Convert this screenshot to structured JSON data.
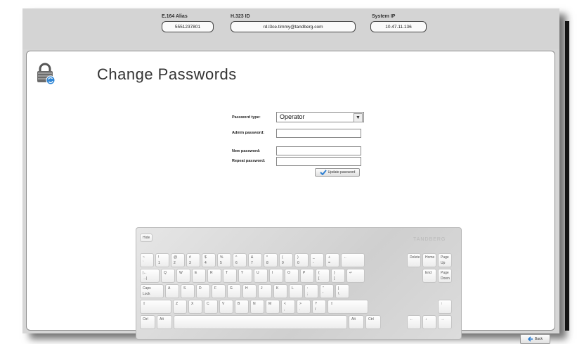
{
  "header": {
    "e164_label": "E.164 Alias",
    "e164_value": "5551237801",
    "h323_label": "H.323 ID",
    "h323_value": "rd.l3ce.timmy@tandberg.com",
    "ip_label": "System IP",
    "ip_value": "10.47.11.136"
  },
  "page": {
    "title": "Change Passwords",
    "icon": "lock-icon"
  },
  "form": {
    "password_type_label": "Password type:",
    "password_type_value": "Operator",
    "admin_password_label": "Admin password:",
    "new_password_label": "New password:",
    "repeat_password_label": "Repeat password:",
    "update_button_label": "Update password"
  },
  "keyboard": {
    "hide_label": "Hide",
    "brand": "TANDBERG",
    "row1": [
      {
        "t": "~",
        "b": "`"
      },
      {
        "t": "!",
        "b": "1"
      },
      {
        "t": "@",
        "b": "2"
      },
      {
        "t": "#",
        "b": "3"
      },
      {
        "t": "$",
        "b": "4"
      },
      {
        "t": "%",
        "b": "5"
      },
      {
        "t": "^",
        "b": "6"
      },
      {
        "t": "&",
        "b": "7"
      },
      {
        "t": "*",
        "b": "8"
      },
      {
        "t": "(",
        "b": "9"
      },
      {
        "t": ")",
        "b": "0"
      },
      {
        "t": "_",
        "b": "-"
      },
      {
        "t": "+",
        "b": "="
      },
      {
        "t": "←",
        "b": ""
      }
    ],
    "row2": [
      {
        "t": "|←",
        "b": "→|"
      },
      {
        "t": "Q",
        "b": ""
      },
      {
        "t": "W",
        "b": ""
      },
      {
        "t": "E",
        "b": ""
      },
      {
        "t": "R",
        "b": ""
      },
      {
        "t": "T",
        "b": ""
      },
      {
        "t": "Y",
        "b": ""
      },
      {
        "t": "U",
        "b": ""
      },
      {
        "t": "I",
        "b": ""
      },
      {
        "t": "O",
        "b": ""
      },
      {
        "t": "P",
        "b": ""
      },
      {
        "t": "{",
        "b": "["
      },
      {
        "t": "}",
        "b": "]"
      },
      {
        "t": "↵",
        "b": ""
      }
    ],
    "row3": [
      {
        "t": "Caps",
        "b": "Lock"
      },
      {
        "t": "A",
        "b": ""
      },
      {
        "t": "S",
        "b": ""
      },
      {
        "t": "D",
        "b": ""
      },
      {
        "t": "F",
        "b": ""
      },
      {
        "t": "G",
        "b": ""
      },
      {
        "t": "H",
        "b": ""
      },
      {
        "t": "J",
        "b": ""
      },
      {
        "t": "K",
        "b": ""
      },
      {
        "t": "L",
        "b": ""
      },
      {
        "t": ":",
        "b": ";"
      },
      {
        "t": "\"",
        "b": "'"
      },
      {
        "t": "|",
        "b": "\\"
      }
    ],
    "row4": [
      {
        "t": "⇧",
        "b": ""
      },
      {
        "t": "Z",
        "b": ""
      },
      {
        "t": "X",
        "b": ""
      },
      {
        "t": "C",
        "b": ""
      },
      {
        "t": "V",
        "b": ""
      },
      {
        "t": "B",
        "b": ""
      },
      {
        "t": "N",
        "b": ""
      },
      {
        "t": "M",
        "b": ""
      },
      {
        "t": "<",
        "b": ","
      },
      {
        "t": ">",
        "b": "."
      },
      {
        "t": "?",
        "b": "/"
      },
      {
        "t": "⇧",
        "b": ""
      }
    ],
    "row5": [
      {
        "t": "Ctrl",
        "b": ""
      },
      {
        "t": "Alt",
        "b": ""
      },
      {
        "t": "",
        "b": ""
      },
      {
        "t": "Alt",
        "b": ""
      },
      {
        "t": "Ctrl",
        "b": ""
      }
    ],
    "nav": [
      {
        "t": "Delete",
        "b": ""
      },
      {
        "t": "Home",
        "b": ""
      },
      {
        "t": "Page",
        "b": "Up"
      },
      {
        "t": "End",
        "b": ""
      },
      {
        "t": "Page",
        "b": "Down"
      },
      {
        "t": "↑",
        "b": ""
      },
      {
        "t": "←",
        "b": ""
      },
      {
        "t": "↓",
        "b": ""
      },
      {
        "t": "→",
        "b": ""
      }
    ]
  },
  "footer": {
    "back_label": "Back"
  }
}
